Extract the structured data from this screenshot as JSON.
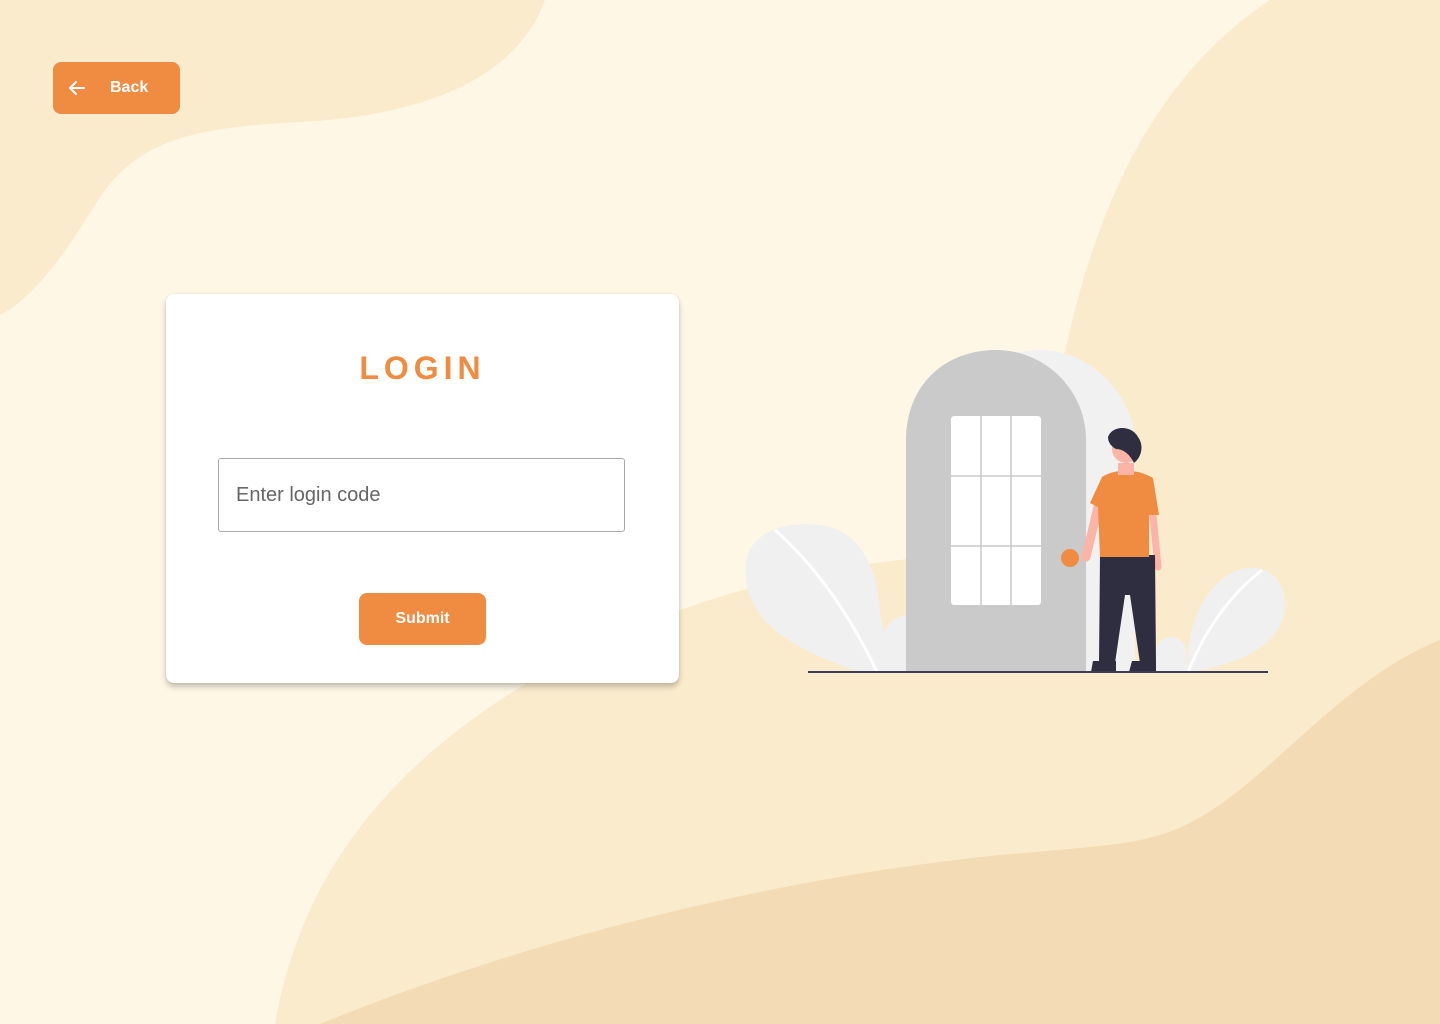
{
  "back_button": {
    "label": "Back",
    "icon": "arrow-left-icon"
  },
  "login": {
    "title": "LOGIN",
    "input_placeholder": "Enter login code",
    "input_value": "",
    "submit_label": "Submit"
  },
  "colors": {
    "accent": "#ef8c41",
    "background": "#fff7e5",
    "wave_light": "#fbebcd",
    "wave_dark": "#f3dbb5"
  }
}
